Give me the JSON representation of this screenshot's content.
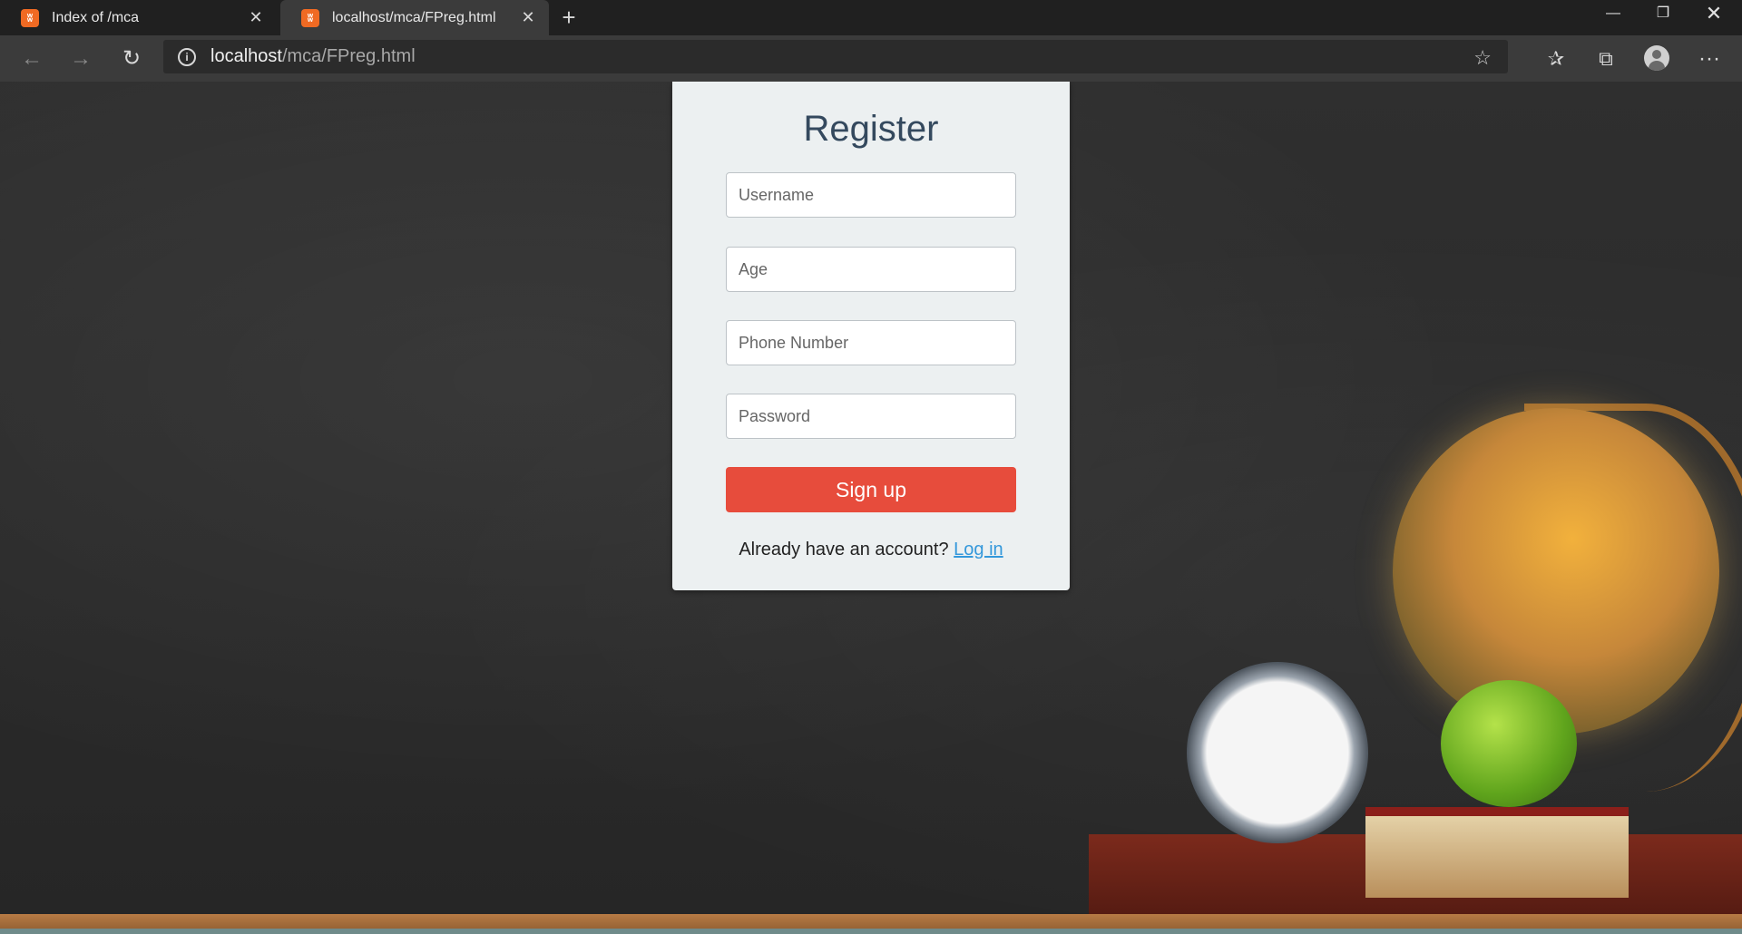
{
  "browser": {
    "tabs": [
      {
        "label": "Index of /mca",
        "favicon": "xampp-icon"
      },
      {
        "label": "localhost/mca/FPreg.html",
        "favicon": "xampp-icon"
      }
    ],
    "address": {
      "host": "localhost",
      "path": "/mca/FPreg.html"
    }
  },
  "form": {
    "title": "Register",
    "fields": [
      {
        "placeholder": "Username",
        "value": ""
      },
      {
        "placeholder": "Age",
        "value": ""
      },
      {
        "placeholder": "Phone Number",
        "value": ""
      },
      {
        "placeholder": "Password",
        "value": ""
      }
    ],
    "submit_label": "Sign up",
    "login_prompt": "Already have an account?",
    "login_link": "Log in"
  },
  "colors": {
    "button": "#e74c3c",
    "link": "#3498db",
    "card": "#ecf0f1",
    "title": "#34495e"
  }
}
